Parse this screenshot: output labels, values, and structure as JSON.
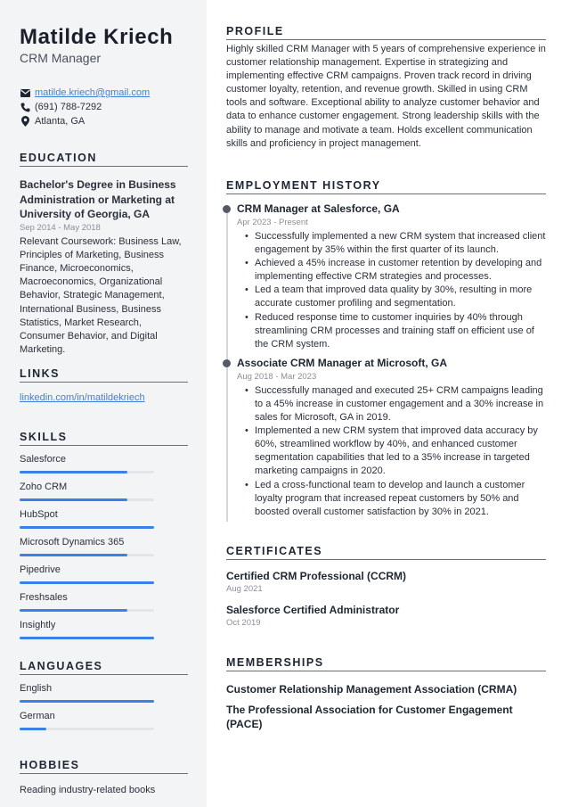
{
  "header": {
    "name": "Matilde Kriech",
    "title": "CRM Manager"
  },
  "contact": {
    "email": "matilde.kriech@gmail.com",
    "phone": "(691) 788-7292",
    "location": "Atlanta, GA",
    "icons": [
      "envelope-icon",
      "phone-icon",
      "map-pin-icon"
    ]
  },
  "education": {
    "heading": "EDUCATION",
    "degree": "Bachelor's Degree in Business Administration or Marketing at University of Georgia, GA",
    "dates": "Sep 2014 - May 2018",
    "description": "Relevant Coursework: Business Law, Principles of Marketing, Business Finance, Microeconomics, Macroeconomics, Organizational Behavior, Strategic Management, International Business, Business Statistics, Market Research, Consumer Behavior, and Digital Marketing."
  },
  "links": {
    "heading": "LINKS",
    "items": [
      "linkedin.com/in/matildekriech"
    ]
  },
  "skills": {
    "heading": "SKILLS",
    "items": [
      {
        "label": "Salesforce",
        "level": 0.8
      },
      {
        "label": "Zoho CRM",
        "level": 0.8
      },
      {
        "label": "HubSpot",
        "level": 1.0
      },
      {
        "label": "Microsoft Dynamics 365",
        "level": 0.8
      },
      {
        "label": "Pipedrive",
        "level": 1.0
      },
      {
        "label": "Freshsales",
        "level": 0.8
      },
      {
        "label": "Insightly",
        "level": 1.0
      }
    ]
  },
  "languages": {
    "heading": "LANGUAGES",
    "items": [
      {
        "label": "English",
        "level": 1.0
      },
      {
        "label": "German",
        "level": 0.2
      }
    ]
  },
  "hobbies": {
    "heading": "HOBBIES",
    "items": [
      "Reading industry-related books"
    ]
  },
  "profile": {
    "heading": "PROFILE",
    "text": "Highly skilled CRM Manager with 5 years of comprehensive experience in customer relationship management. Expertise in strategizing and implementing effective CRM campaigns. Proven track record in driving customer loyalty, retention, and revenue growth. Skilled in using CRM tools and software. Exceptional ability to analyze customer behavior and data to enhance customer engagement. Strong leadership skills with the ability to manage and motivate a team. Holds excellent communication skills and proficiency in project management."
  },
  "employment": {
    "heading": "EMPLOYMENT HISTORY",
    "jobs": [
      {
        "title": "CRM Manager at Salesforce, GA",
        "dates": "Apr 2023 - Present",
        "bullets": [
          "Successfully implemented a new CRM system that increased client engagement by 35% within the first quarter of its launch.",
          "Achieved a 45% increase in customer retention by developing and implementing effective CRM strategies and processes.",
          "Led a team that improved data quality by 30%, resulting in more accurate customer profiling and segmentation.",
          "Reduced response time to customer inquiries by 40% through streamlining CRM processes and training staff on efficient use of the CRM system."
        ]
      },
      {
        "title": "Associate CRM Manager at Microsoft, GA",
        "dates": "Aug 2018 - Mar 2023",
        "bullets": [
          "Successfully managed and executed 25+ CRM campaigns leading to a 45% increase in customer engagement and a 30% increase in sales for Microsoft, GA in 2019.",
          "Implemented a new CRM system that improved data accuracy by 60%, streamlined workflow by 40%, and enhanced customer segmentation capabilities that led to a 35% increase in targeted marketing campaigns in 2020.",
          "Led a cross-functional team to develop and launch a customer loyalty program that increased repeat customers by 50% and boosted overall customer satisfaction by 30% in 2021."
        ]
      }
    ]
  },
  "certificates": {
    "heading": "CERTIFICATES",
    "items": [
      {
        "name": "Certified CRM Professional (CCRM)",
        "date": "Aug 2021"
      },
      {
        "name": "Salesforce Certified Administrator",
        "date": "Oct 2019"
      }
    ]
  },
  "memberships": {
    "heading": "MEMBERSHIPS",
    "items": [
      "Customer Relationship Management Association (CRMA)",
      "The Professional Association for Customer Engagement (PACE)"
    ]
  },
  "colors": {
    "accent": "#3b80e6",
    "link": "#3f7fd9",
    "sidebar_bg": "#f3f4f6",
    "bar_track": "#e3e5e9"
  }
}
